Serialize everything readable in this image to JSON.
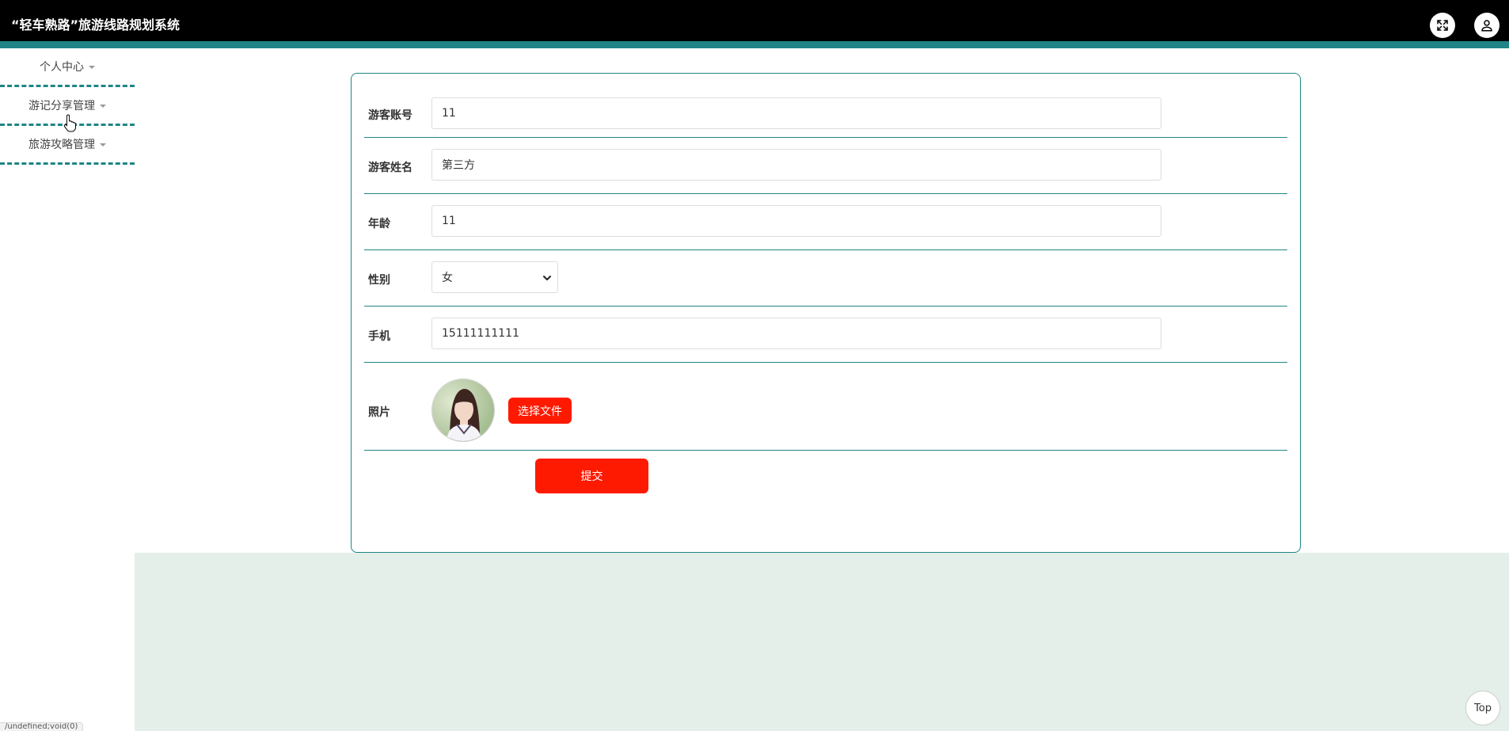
{
  "app": {
    "title": "“轻车熟路”旅游线路规划系统"
  },
  "header": {
    "icons": [
      "fullscreen-icon",
      "user-icon"
    ]
  },
  "sidebar": {
    "items": [
      {
        "label": "个人中心"
      },
      {
        "label": "游记分享管理"
      },
      {
        "label": "旅游攻略管理"
      }
    ]
  },
  "form": {
    "account": {
      "label": "游客账号",
      "value": "11"
    },
    "name": {
      "label": "游客姓名",
      "value": "第三方"
    },
    "age": {
      "label": "年龄",
      "value": "11"
    },
    "gender": {
      "label": "性别",
      "value": "女"
    },
    "phone": {
      "label": "手机",
      "value": "15111111111"
    },
    "photo": {
      "label": "照片",
      "button": "选择文件"
    },
    "submit": "提交"
  },
  "back_to_top": "Top",
  "status_bar": {
    "url": "/undefined;void(0)"
  },
  "colors": {
    "topbar": "#000000",
    "accent": "#1f8587",
    "button": "#fe1a00",
    "content_bg": "#e4efe9"
  }
}
